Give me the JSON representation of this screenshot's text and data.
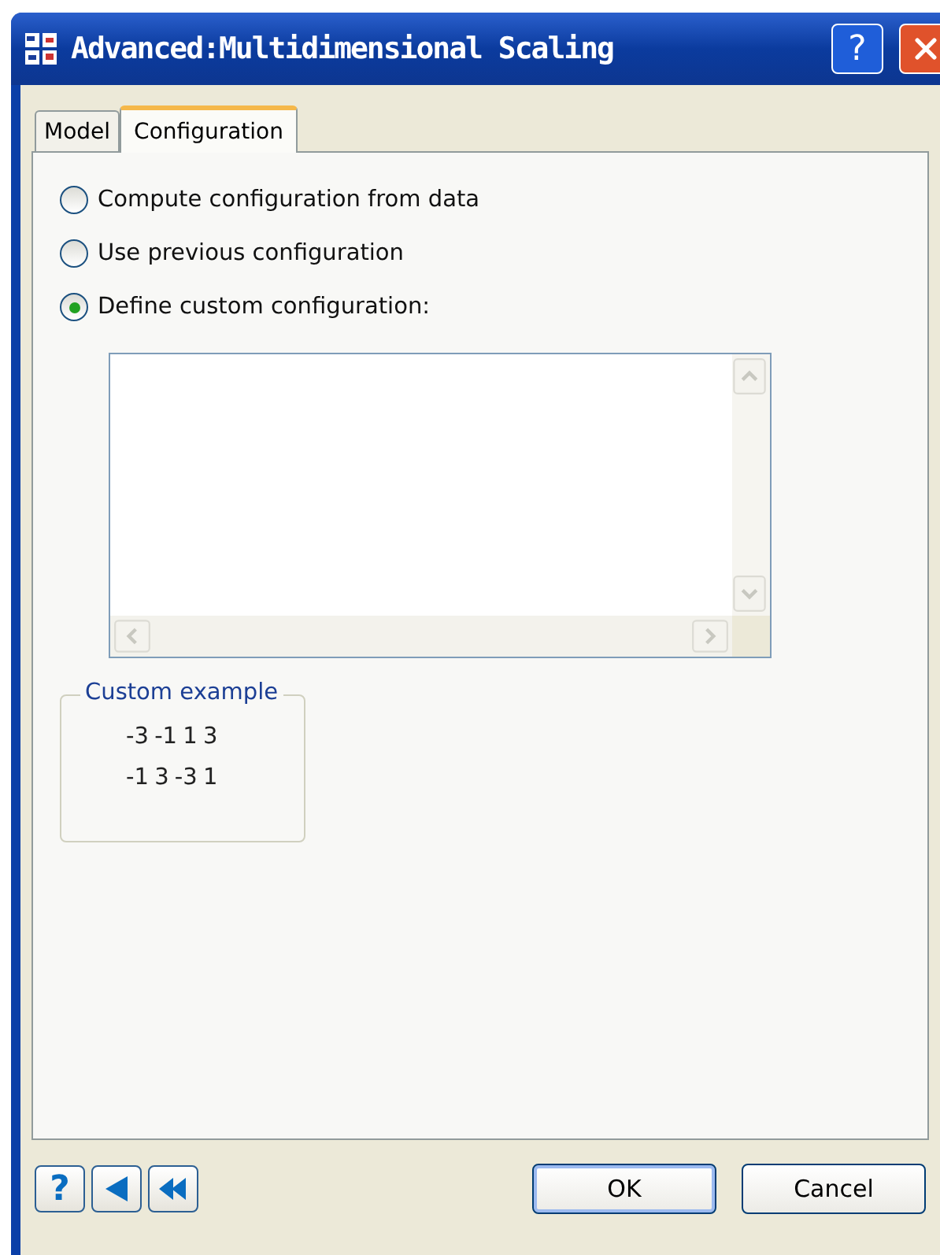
{
  "window": {
    "title": "Advanced:Multidimensional Scaling",
    "help_button": "?"
  },
  "tabs": [
    {
      "label": "Model",
      "selected": false
    },
    {
      "label": "Configuration",
      "selected": true
    }
  ],
  "options": [
    {
      "label": "Compute configuration from data",
      "selected": false
    },
    {
      "label": "Use previous configuration",
      "selected": false
    },
    {
      "label": "Define custom configuration:",
      "selected": true
    }
  ],
  "custom_example": {
    "title": "Custom example",
    "lines": [
      "-3 -1 1 3",
      "-1 3 -3 1"
    ]
  },
  "footer": {
    "help_button": "?",
    "buttons": [
      {
        "label": "OK",
        "default": true
      },
      {
        "label": "Cancel",
        "default": false
      }
    ]
  }
}
